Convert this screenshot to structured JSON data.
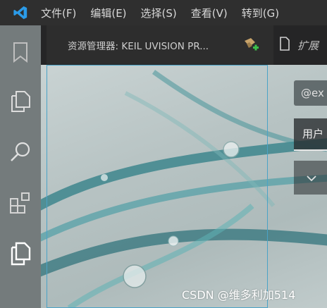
{
  "menubar": {
    "items": [
      "文件(F)",
      "编辑(E)",
      "选择(S)",
      "查看(V)",
      "转到(G)"
    ]
  },
  "activity_bar": {
    "icons": [
      "bookmark-icon",
      "explorer-icon",
      "search-icon",
      "extensions-icon",
      "explorer-icon"
    ]
  },
  "tabs": [
    {
      "label": "资源管理器: KEIL UVISION PR..."
    },
    {
      "label": "扩展"
    }
  ],
  "extensions_panel": {
    "search_value": "@ex",
    "user_tab_label": "用户",
    "section_chevron": "chevron-down-icon"
  },
  "watermark": "CSDN @维多利加514",
  "colors": {
    "menubar_bg": "#2f2f2f",
    "logo_blue": "#2b9be8",
    "selection_border": "#4aa3c7"
  }
}
